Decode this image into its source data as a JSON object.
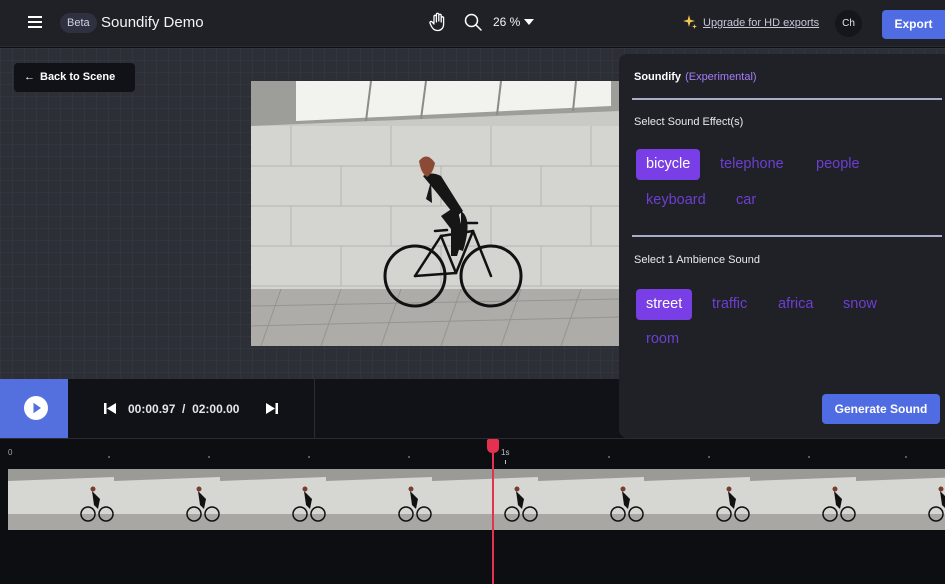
{
  "header": {
    "beta_badge": "Beta",
    "title": "Soundify Demo",
    "zoom_level": "26 %",
    "upgrade_link": "Upgrade for HD exports",
    "avatar_initials": "Ch",
    "export_label": "Export"
  },
  "canvas": {
    "back_label": "Back to Scene"
  },
  "panel": {
    "title": "Soundify",
    "subtitle": "(Experimental)",
    "effects_label": "Select Sound Effect(s)",
    "effects": [
      {
        "label": "bicycle",
        "selected": true
      },
      {
        "label": "telephone",
        "selected": false
      },
      {
        "label": "people",
        "selected": false
      },
      {
        "label": "keyboard",
        "selected": false
      },
      {
        "label": "car",
        "selected": false
      }
    ],
    "ambience_label": "Select 1 Ambience Sound",
    "ambience": [
      {
        "label": "street",
        "selected": true
      },
      {
        "label": "traffic",
        "selected": false
      },
      {
        "label": "africa",
        "selected": false
      },
      {
        "label": "snow",
        "selected": false
      },
      {
        "label": "room",
        "selected": false
      }
    ],
    "generate_label": "Generate Sound"
  },
  "player": {
    "current_time": "00:00.97",
    "separator": "/",
    "total_time": "02:00.00"
  },
  "timeline": {
    "start_label": "0",
    "marker_label": "1s"
  },
  "colors": {
    "accent_blue": "#4f6ce2",
    "chip_selected": "#7a3ee6",
    "chip_text": "#6b3fd1",
    "playhead": "#e5304f"
  },
  "icons": {
    "menu": "hamburger-icon",
    "pan": "hand-icon",
    "zoom": "magnifier-icon",
    "upgrade": "sparkle-icon",
    "back": "arrow-left-icon",
    "play": "play-icon",
    "skip_back": "skip-start-icon",
    "skip_forward": "skip-end-icon"
  }
}
